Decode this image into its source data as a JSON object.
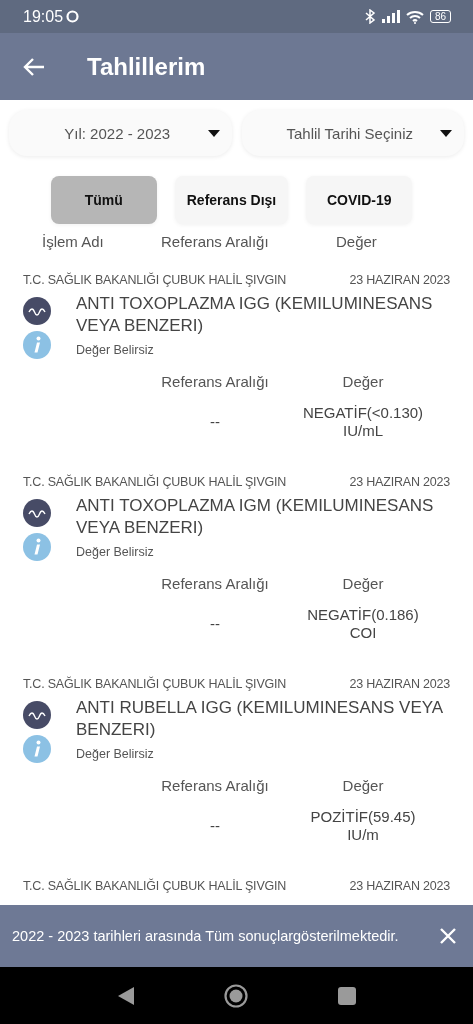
{
  "status_bar": {
    "time": "19:05",
    "battery": "86"
  },
  "app_bar": {
    "title": "Tahlillerim"
  },
  "dropdowns": [
    {
      "value": "Yıl: 2022 - 2023"
    },
    {
      "value": "Tahlil Tarihi Seçiniz"
    }
  ],
  "filters": [
    {
      "label": "Tümü",
      "selected": true
    },
    {
      "label": "Referans Dışı",
      "selected": false
    },
    {
      "label": "COVID-19",
      "selected": false
    }
  ],
  "columns": [
    "İşlem Adı",
    "Referans Aralığı",
    "Değer"
  ],
  "results": [
    {
      "institution": "T.C. SAĞLIK BAKANLIĞI ÇUBUK HALİL ŞIVGIN",
      "date": "23 HAZIRAN 2023",
      "test": "ANTI TOXOPLAZMA IGG (KEMILUMINESANS VEYA BENZERI)",
      "status": "Değer Belirsiz",
      "range_label": "Referans Aralığı",
      "value_label": "Değer",
      "range": "--",
      "value": "NEGATİF(<0.130)",
      "unit": "IU/mL"
    },
    {
      "institution": "T.C. SAĞLIK BAKANLIĞI ÇUBUK HALİL ŞIVGIN",
      "date": "23 HAZIRAN 2023",
      "test": "ANTI TOXOPLAZMA IGM (KEMILUMINESANS VEYA BENZERI)",
      "status": "Değer Belirsiz",
      "range_label": "Referans Aralığı",
      "value_label": "Değer",
      "range": "--",
      "value": "NEGATİF(0.186)",
      "unit": "COI"
    },
    {
      "institution": "T.C. SAĞLIK BAKANLIĞI ÇUBUK HALİL ŞIVGIN",
      "date": "23 HAZIRAN 2023",
      "test": "ANTI RUBELLA IGG (KEMILUMINESANS VEYA BENZERI)",
      "status": "Değer Belirsiz",
      "range_label": "Referans Aralığı",
      "value_label": "Değer",
      "range": "--",
      "value": "POZİTİF(59.45)",
      "unit": "IU/m"
    },
    {
      "institution": "T.C. SAĞLIK BAKANLIĞI ÇUBUK HALİL ŞIVGIN",
      "date": "23 HAZIRAN 2023"
    }
  ],
  "snackbar": {
    "message": "2022 - 2023 tarihleri arasında Tüm sonuçlargösterilmektedir."
  }
}
